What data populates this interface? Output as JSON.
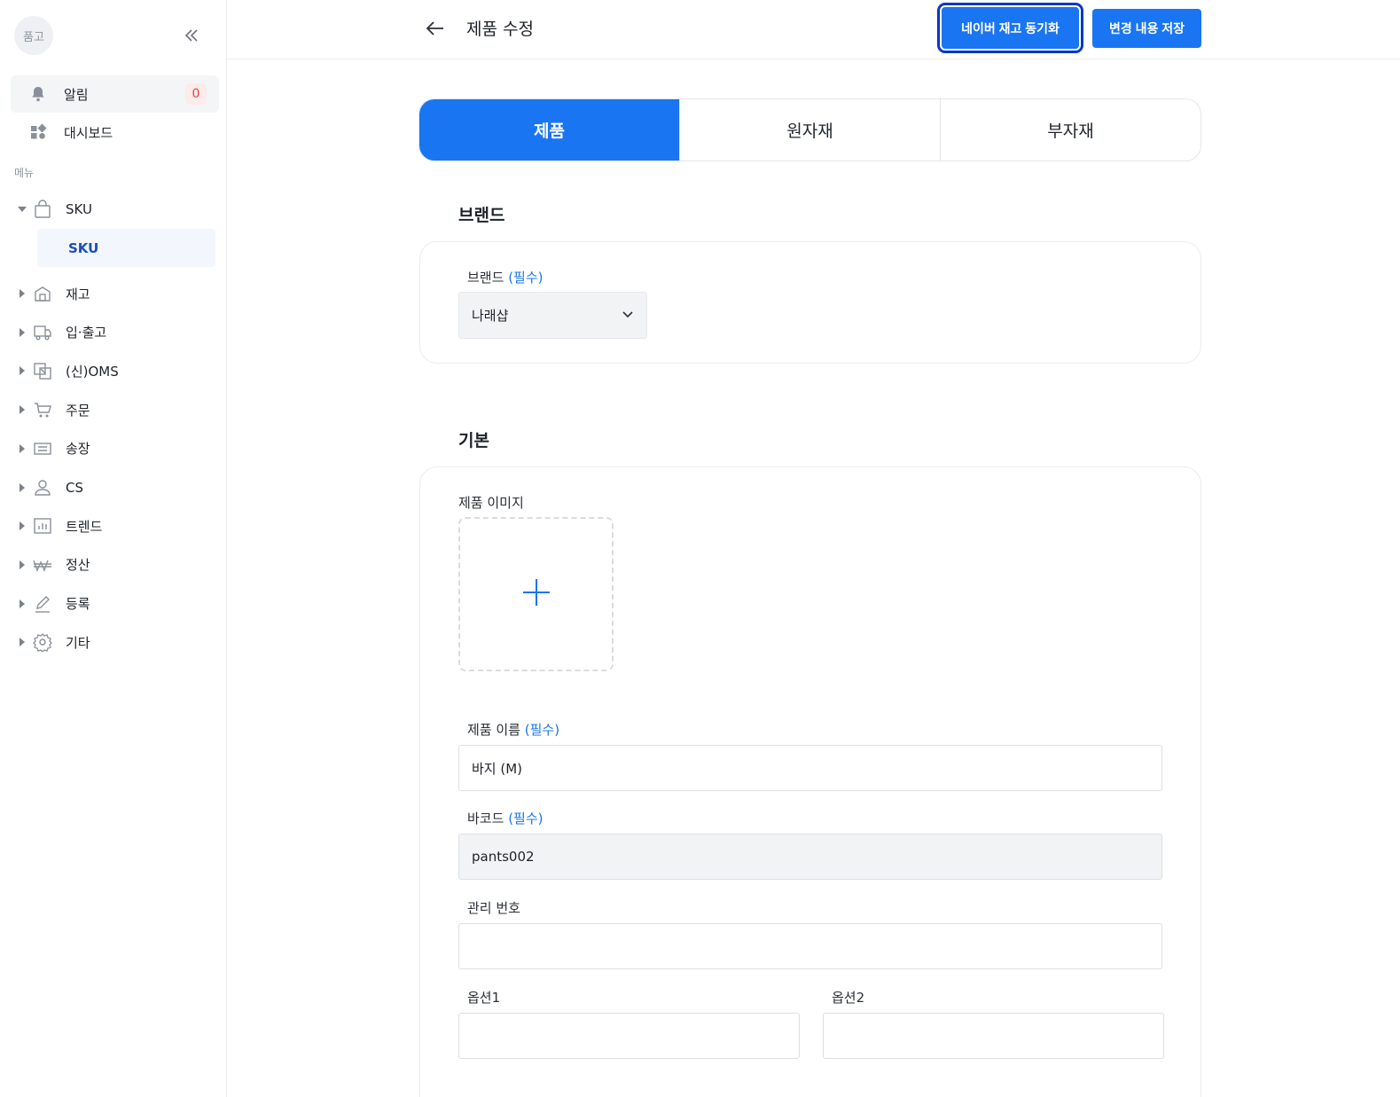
{
  "sidebar": {
    "avatar_text": "품고",
    "alarm_label": "알림",
    "alarm_count": "0",
    "dashboard_label": "대시보드",
    "menu_label": "메뉴",
    "sku_label": "SKU",
    "sku_sub_label": "SKU",
    "items": [
      {
        "label": "재고",
        "icon": "warehouse-icon"
      },
      {
        "label": "입·출고",
        "icon": "truck-icon"
      },
      {
        "label": "(신)OMS",
        "icon": "oms-icon"
      },
      {
        "label": "주문",
        "icon": "cart-icon"
      },
      {
        "label": "송장",
        "icon": "invoice-icon"
      },
      {
        "label": "CS",
        "icon": "person-icon"
      },
      {
        "label": "트렌드",
        "icon": "bar-chart-icon"
      },
      {
        "label": "정산",
        "icon": "won-icon"
      },
      {
        "label": "등록",
        "icon": "pencil-icon"
      },
      {
        "label": "기타",
        "icon": "gear-icon"
      }
    ]
  },
  "header": {
    "title": "제품 수정",
    "sync_button": "네이버 재고 동기화",
    "save_button": "변경 내용 저장"
  },
  "tabs": [
    {
      "label": "제품",
      "active": true
    },
    {
      "label": "원자재",
      "active": false
    },
    {
      "label": "부자재",
      "active": false
    }
  ],
  "brand_section": {
    "title": "브랜드",
    "field_label": "브랜드",
    "required": "(필수)",
    "selected_value": "나래샵"
  },
  "basic_section": {
    "title": "기본",
    "image_label": "제품 이미지",
    "name_label": "제품 이름",
    "name_required": "(필수)",
    "name_value": "바지 (M)",
    "barcode_label": "바코드",
    "barcode_required": "(필수)",
    "barcode_value": "pants002",
    "manage_label": "관리 번호",
    "manage_value": "",
    "option1_label": "옵션1",
    "option1_value": "",
    "option2_label": "옵션2",
    "option2_value": ""
  },
  "colors": {
    "primary": "#1a75f2",
    "focus_outline": "#0a37c2",
    "badge_text": "#e24545"
  }
}
